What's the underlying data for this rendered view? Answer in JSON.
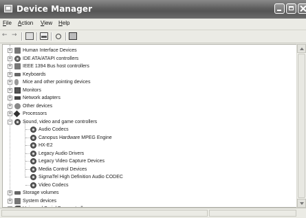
{
  "window": {
    "title": "Device Manager"
  },
  "menu": {
    "file": "File",
    "action": "Action",
    "view": "View",
    "help": "Help"
  },
  "tree": {
    "categories": [
      {
        "label": "Human Interface Devices",
        "icon": "hid-icon",
        "expanded": false
      },
      {
        "label": "IDE ATA/ATAPI controllers",
        "icon": "ide-icon",
        "expanded": false
      },
      {
        "label": "IEEE 1394 Bus host controllers",
        "icon": "ieee1394-icon",
        "expanded": false
      },
      {
        "label": "Keyboards",
        "icon": "keyboard-icon",
        "expanded": false
      },
      {
        "label": "Mice and other pointing devices",
        "icon": "mouse-icon",
        "expanded": false
      },
      {
        "label": "Monitors",
        "icon": "monitor-icon",
        "expanded": false
      },
      {
        "label": "Network adapters",
        "icon": "network-icon",
        "expanded": false
      },
      {
        "label": "Other devices",
        "icon": "unknown-device-icon",
        "expanded": false
      },
      {
        "label": "Processors",
        "icon": "processor-icon",
        "expanded": false
      },
      {
        "label": "Sound, video and game controllers",
        "icon": "sound-icon",
        "expanded": true
      },
      {
        "label": "Storage volumes",
        "icon": "storage-icon",
        "expanded": false
      },
      {
        "label": "System devices",
        "icon": "system-icon",
        "expanded": false
      },
      {
        "label": "Universal Serial Bus controllers",
        "icon": "usb-icon",
        "expanded": false
      }
    ],
    "sound_children": [
      "Audio Codecs",
      "Canopus Hardware MPEG Engine",
      "HX-E2",
      "Legacy Audio Drivers",
      "Legacy Video Capture Devices",
      "Media Control Devices",
      "SigmaTel High Definition Audio CODEC",
      "Video Codecs"
    ]
  }
}
